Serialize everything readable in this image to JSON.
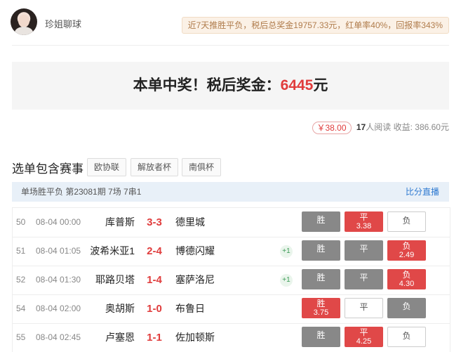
{
  "header": {
    "username": "珍姐聊球",
    "stats": "近7天推胜平负，税后总奖金19757.33元，红单率40%，回报率343%"
  },
  "banner": {
    "prefix": "本单中奖！税后奖金：",
    "amount": "6445",
    "suffix": "元"
  },
  "meta": {
    "price": "￥38.00",
    "reads_count": "17",
    "reads_label": "人阅读",
    "income_label": "收益:",
    "income_value": "386.60元"
  },
  "section": {
    "title": "选单包含赛事",
    "leagues": [
      "欧协联",
      "解放者杯",
      "南俱杯"
    ]
  },
  "info_bar": {
    "left": "单场胜平负 第23081期 7场 7串1",
    "right": "比分直播"
  },
  "matches": [
    {
      "num": "50",
      "time": "08-04 00:00",
      "home": "库普斯",
      "score": "3-3",
      "away": "德里城",
      "plus": "",
      "options": [
        {
          "label": "胜",
          "odds": "",
          "state": "gray"
        },
        {
          "label": "平",
          "odds": "3.38",
          "state": "red"
        },
        {
          "label": "负",
          "odds": "",
          "state": "white"
        }
      ]
    },
    {
      "num": "51",
      "time": "08-04 01:05",
      "home": "波希米亚1",
      "score": "2-4",
      "away": "博德闪耀",
      "plus": "+1",
      "options": [
        {
          "label": "胜",
          "odds": "",
          "state": "gray"
        },
        {
          "label": "平",
          "odds": "",
          "state": "gray"
        },
        {
          "label": "负",
          "odds": "2.49",
          "state": "red"
        }
      ]
    },
    {
      "num": "52",
      "time": "08-04 01:30",
      "home": "耶路贝塔",
      "score": "1-4",
      "away": "塞萨洛尼",
      "plus": "+1",
      "options": [
        {
          "label": "胜",
          "odds": "",
          "state": "gray"
        },
        {
          "label": "平",
          "odds": "",
          "state": "gray"
        },
        {
          "label": "负",
          "odds": "4.30",
          "state": "red"
        }
      ]
    },
    {
      "num": "54",
      "time": "08-04 02:00",
      "home": "奥胡斯",
      "score": "1-0",
      "away": "布鲁日",
      "plus": "",
      "options": [
        {
          "label": "胜",
          "odds": "3.75",
          "state": "red"
        },
        {
          "label": "平",
          "odds": "",
          "state": "white"
        },
        {
          "label": "负",
          "odds": "",
          "state": "gray"
        }
      ]
    },
    {
      "num": "55",
      "time": "08-04 02:45",
      "home": "卢塞恩",
      "score": "1-1",
      "away": "佐加顿斯",
      "plus": "",
      "options": [
        {
          "label": "胜",
          "odds": "",
          "state": "gray"
        },
        {
          "label": "平",
          "odds": "4.25",
          "state": "red"
        },
        {
          "label": "负",
          "odds": "",
          "state": "white"
        }
      ]
    }
  ]
}
